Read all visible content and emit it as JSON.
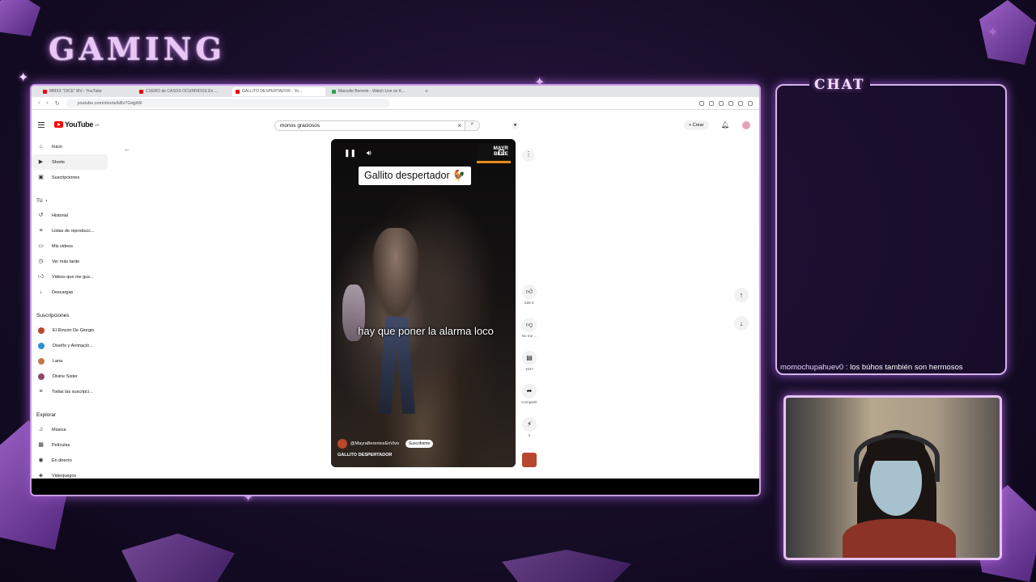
{
  "overlay": {
    "title": "GAMING",
    "chat_title": "CHAT",
    "chat_message": {
      "user": "momochupahuev0",
      "text": " : los búhos también son hermosos"
    }
  },
  "browser": {
    "tabs": [
      {
        "label": "MMXX \"DICE\" MV - YouTube",
        "active": false,
        "icon": "youtube"
      },
      {
        "label": "CUERO de CASOS OCURRIDOS En ...",
        "active": false,
        "icon": "youtube"
      },
      {
        "label": "GALLITO DESPERTADOR - Yo...",
        "active": true,
        "icon": "youtube"
      },
      {
        "label": "Marcelle Berenin - Watch Live on K...",
        "active": false,
        "icon": "kick"
      }
    ],
    "new_tab": "+",
    "url": "youtube.com/shorts/kBv7GdgWiI"
  },
  "youtube": {
    "logo_text": "YouTube",
    "logo_sup": "AR",
    "search_value": "monos graciosos",
    "create_label": "+ Crear",
    "sidebar": {
      "main": [
        {
          "label": "Inicio",
          "icon": "home-icon"
        },
        {
          "label": "Shorts",
          "icon": "shorts-icon"
        },
        {
          "label": "Suscripciones",
          "icon": "subscriptions-icon"
        }
      ],
      "you_header": "Tú",
      "you": [
        {
          "label": "Historial",
          "icon": "history-icon"
        },
        {
          "label": "Listas de reproducc...",
          "icon": "playlist-icon"
        },
        {
          "label": "Mis videos",
          "icon": "video-icon"
        },
        {
          "label": "Ver más tarde",
          "icon": "clock-icon"
        },
        {
          "label": "Videos que me gus...",
          "icon": "like-icon"
        },
        {
          "label": "Descargas",
          "icon": "download-icon"
        }
      ],
      "subs_header": "Suscripciones",
      "subs": [
        {
          "label": "El Rincón De Giorgio",
          "color": "#b8472e"
        },
        {
          "label": "Diseño y Animació...",
          "color": "#2f8fd6"
        },
        {
          "label": "Lana",
          "color": "#c07a4a"
        },
        {
          "label": "Divine Sister",
          "color": "#8a4a6a"
        },
        {
          "label": "Todas las suscripci...",
          "color": ""
        }
      ],
      "explore_header": "Explorar",
      "explore": [
        {
          "label": "Música",
          "icon": "music-icon"
        },
        {
          "label": "Películas",
          "icon": "film-icon"
        },
        {
          "label": "En directo",
          "icon": "live-icon"
        },
        {
          "label": "Videojuegos",
          "icon": "game-icon"
        }
      ]
    },
    "short": {
      "title_card": "Gallito despertador 🐓",
      "caption": "hay que poner la alarma loco",
      "channel": "@MayraBereniceEnVivo",
      "subscribe": "Suscribirme",
      "title": "GALLITO DESPERTADOR",
      "badge": "MAYR BERE"
    },
    "actions": {
      "likes": "526 K",
      "dislike": "No me ...",
      "comments": "1047",
      "share": "Compartir",
      "remix": "2"
    }
  }
}
